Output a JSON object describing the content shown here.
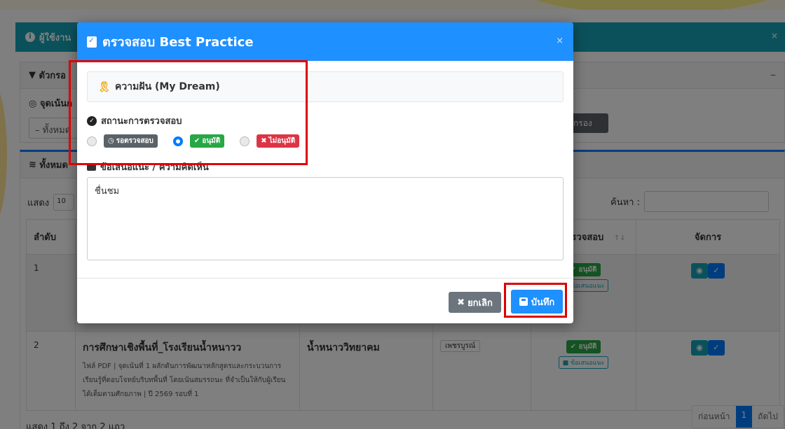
{
  "background": {
    "alert": {
      "text": "ผู้ใช้งาน",
      "close": "×"
    },
    "filter": {
      "title": "ตัวกรอ",
      "focus_label": "จุดเน้นก",
      "select_value": "– ทั้งหมด",
      "button": "กรอง",
      "collapse": "–"
    },
    "list": {
      "title": "ทั้งหมด",
      "show_label": "แสดง",
      "show_value": "10",
      "search_label": "ค้นหา :",
      "columns": [
        "ลำดับ",
        "สถานะตรวจสอบ",
        "จัดการ"
      ],
      "sort_icon": "↑↓",
      "rows": [
        {
          "no": "1",
          "status_badge": "อนุมัติ",
          "note_badge": "ข้อเสนอแนะ"
        },
        {
          "no": "2",
          "title": "การศึกษาเชิงพื้นที่_โรงเรียนน้ำหนาวว",
          "school": "น้ำหนาววิทยาคม",
          "province": "เพชรบูรณ์",
          "meta": "ไฟล์ PDF | จุดเน้นที่ 1 ผลักดันการพัฒนาหลักสูตรและกระบวนการเรียนรู้ที่ตอบโจทย์บริบทพื้นที่ โดยเน้นสมรรถนะ ที่จำเป็นให้กับผู้เรียนได้เต็มตามศักยภาพ | ปี 2569 รอบที่ 1",
          "status_badge": "อนุมัติ",
          "note_badge": "ข้อเสนอแนะ"
        }
      ],
      "summary": "แสดง 1 ถึง 2 จาก 2 แถว",
      "pager": {
        "prev": "ก่อนหน้า",
        "page": "1",
        "next": "ถัดไป"
      }
    }
  },
  "modal": {
    "title": "ตรวจสอบ Best Practice",
    "close": "×",
    "category": "ความฝัน (My Dream)",
    "status_label": "สถานะการตรวจสอบ",
    "status_options": [
      {
        "label": "รอตรวจสอบ",
        "checked": false,
        "color": "#5a6268"
      },
      {
        "label": "อนุมัติ",
        "checked": true,
        "color": "#28a745"
      },
      {
        "label": "ไม่อนุมัติ",
        "checked": false,
        "color": "#dc3545"
      }
    ],
    "comment_label": "ข้อเสนอแนะ / ความคิดเห็น",
    "comment_value": "ชื่นชม",
    "cancel_label": "ยกเลิก",
    "save_label": "บันทึก"
  },
  "colors": {
    "primary": "#1e90ff",
    "success": "#28a745",
    "danger": "#dc3545",
    "info": "#17a2b8",
    "highlight": "#e00000"
  }
}
